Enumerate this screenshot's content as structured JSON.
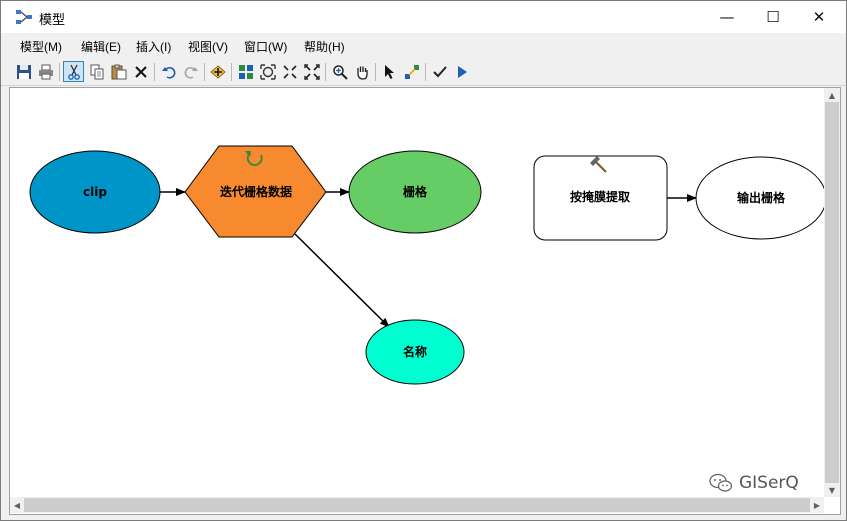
{
  "window": {
    "title": "模型",
    "controls": {
      "minimize": "—",
      "maximize": "☐",
      "close": "✕"
    }
  },
  "menu": [
    "模型(M)",
    "编辑(E)",
    "插入(I)",
    "视图(V)",
    "窗口(W)",
    "帮助(H)"
  ],
  "toolbar": {
    "buttons": [
      {
        "name": "save-icon"
      },
      {
        "name": "print-icon"
      },
      {
        "name": "cut-icon",
        "active": true
      },
      {
        "name": "copy-icon"
      },
      {
        "name": "paste-icon"
      },
      {
        "name": "delete-icon"
      },
      {
        "name": "undo-icon"
      },
      {
        "name": "redo-icon"
      },
      {
        "name": "add-data-icon"
      },
      {
        "name": "auto-layout-icon"
      },
      {
        "name": "full-extent-icon"
      },
      {
        "name": "zoom-in-fixed-icon"
      },
      {
        "name": "zoom-out-fixed-icon"
      },
      {
        "name": "zoom-icon"
      },
      {
        "name": "pan-icon"
      },
      {
        "name": "select-icon"
      },
      {
        "name": "connect-icon"
      },
      {
        "name": "validate-icon"
      },
      {
        "name": "run-icon"
      }
    ]
  },
  "model": {
    "nodes": {
      "clip": {
        "label": "clip",
        "kind": "input-variable",
        "color": "#0095c8"
      },
      "iterate": {
        "label": "迭代栅格数据",
        "kind": "iterator",
        "color": "#f78a2e",
        "icon": "iterate-icon"
      },
      "raster": {
        "label": "栅格",
        "kind": "output-variable",
        "color": "#66cc66"
      },
      "name": {
        "label": "名称",
        "kind": "output-variable",
        "color": "#00ffd0"
      },
      "extract": {
        "label": "按掩膜提取",
        "kind": "tool",
        "color": "#ffffff",
        "icon": "hammer-icon"
      },
      "output": {
        "label": "输出栅格",
        "kind": "output-variable",
        "color": "#ffffff"
      }
    },
    "connections": [
      [
        "clip",
        "iterate"
      ],
      [
        "iterate",
        "raster"
      ],
      [
        "iterate",
        "name"
      ],
      [
        "extract",
        "output"
      ]
    ]
  },
  "scrollbars": {
    "up": "▲",
    "down": "▼",
    "left": "◀",
    "right": "▶"
  },
  "watermark": {
    "text": "GISerQ",
    "icon": "wechat-icon"
  }
}
